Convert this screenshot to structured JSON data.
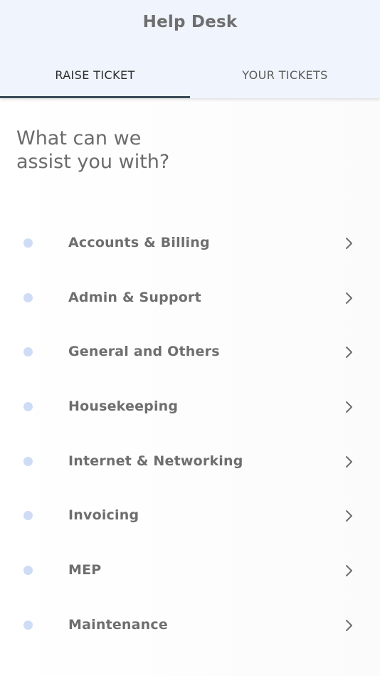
{
  "header": {
    "title": "Help Desk"
  },
  "tabs": [
    {
      "label": "RAISE TICKET",
      "active": true
    },
    {
      "label": "YOUR TICKETS",
      "active": false
    }
  ],
  "main": {
    "question_line1": "What can we",
    "question_line2": "assist you with?",
    "categories": [
      {
        "label": "Accounts & Billing",
        "icon": "chevron-right-icon"
      },
      {
        "label": "Admin & Support",
        "icon": "chevron-right-icon"
      },
      {
        "label": "General and Others",
        "icon": "chevron-right-icon"
      },
      {
        "label": "Housekeeping",
        "icon": "chevron-right-icon"
      },
      {
        "label": "Internet & Networking",
        "icon": "chevron-right-icon"
      },
      {
        "label": "Invoicing",
        "icon": "chevron-right-icon"
      },
      {
        "label": "MEP",
        "icon": "chevron-right-icon"
      },
      {
        "label": "Maintenance",
        "icon": "chevron-right-icon"
      }
    ]
  },
  "colors": {
    "header_bg": "#eff4fd",
    "tab_indicator": "#3a4a58",
    "bullet": "#cfdcf6",
    "text": "#6e6e6e"
  }
}
